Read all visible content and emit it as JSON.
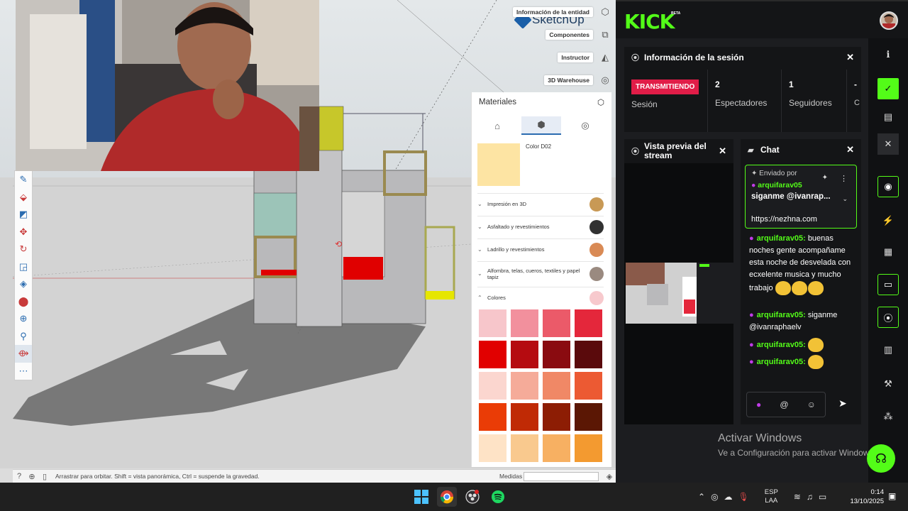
{
  "sketchup": {
    "logo_text": "SketchUp",
    "right_tools": [
      {
        "label": "Información de la entidad",
        "icon": "cube-info-icon",
        "glyph": "⬡"
      },
      {
        "label": "Componentes",
        "icon": "components-icon",
        "glyph": "⧉"
      },
      {
        "label": "Instructor",
        "icon": "instructor-icon",
        "glyph": "◭"
      },
      {
        "label": "3D Warehouse",
        "icon": "warehouse-icon",
        "glyph": "◎"
      }
    ],
    "left_tools": [
      "eraser-icon",
      "paint-bucket-icon",
      "rectangle-icon",
      "move-icon",
      "rotate-icon",
      "scale-icon",
      "tape-measure-icon",
      "pushpull-icon",
      "orbit-icon",
      "zoom-icon",
      "walk-icon",
      "more-icon"
    ],
    "status_text": "Arrastrar para orbitar. Shift = vista panorámica, Ctrl = suspende la gravedad.",
    "medidas_label": "Medidas",
    "materials": {
      "title": "Materiales",
      "tabs": [
        "house-icon",
        "box-icon",
        "target-icon"
      ],
      "selected_color": {
        "name": "Color D02",
        "hex": "#fde4a3"
      },
      "categories": [
        {
          "name": "Impresión en 3D",
          "swatch": "#c89955"
        },
        {
          "name": "Asfaltado y revestimientos",
          "swatch": "#323232"
        },
        {
          "name": "Ladrillo y revestimientos",
          "swatch": "#d98a55"
        },
        {
          "name": "Alfombra, telas, cueros, textiles y papel tapiz",
          "swatch": "#9a8a80"
        },
        {
          "name": "Colores",
          "swatch": "#f7c9cd",
          "expanded": true
        }
      ],
      "colors": [
        "#f7c6cb",
        "#f2909d",
        "#eb5a69",
        "#e4273b",
        "#e10000",
        "#b50b10",
        "#8a0b10",
        "#5a0a0c",
        "#fbd6cf",
        "#f5ab99",
        "#f08866",
        "#ec5a33",
        "#ea3c06",
        "#c02a05",
        "#8d1d04",
        "#5b1704",
        "#fee3c6",
        "#f9c98e",
        "#f7b062",
        "#f39a30"
      ]
    }
  },
  "kick": {
    "logo": "KICK",
    "beta": "BETA",
    "session": {
      "title": "Información de la sesión",
      "badge": "TRANSMITIENDO",
      "stats": [
        {
          "value": "",
          "label": "Sesión"
        },
        {
          "value": "2",
          "label": "Espectadores"
        },
        {
          "value": "1",
          "label": "Seguidores"
        },
        {
          "value": "-",
          "label": "C s"
        }
      ]
    },
    "preview": {
      "title": "Vista previa del stream"
    },
    "chat": {
      "title": "Chat",
      "pinned": {
        "label": "Enviado por",
        "user": "arquifarav05",
        "message": "siganme @ivanrap...",
        "link": "https://nezhna.com"
      },
      "messages": [
        {
          "user": "arquifarav05:",
          "text": "buenas noches gente acompañame esta noche de desvelada con ecxelente musica y mucho trabajo"
        },
        {
          "user": "arquifarav05:",
          "text": "siganme @ivanraphaelv"
        },
        {
          "user": "arquifarav05:",
          "text": ""
        },
        {
          "user": "arquifarav05:",
          "text": ""
        }
      ],
      "input_at": "@"
    },
    "rail": [
      "info-icon",
      "check-icon",
      "layout-icon",
      "close-icon",
      "camera-icon",
      "bolt-icon",
      "notes-icon",
      "chat-icon",
      "broadcast-icon",
      "media-icon",
      "wrench-icon",
      "share-icon"
    ]
  },
  "windows": {
    "activate_title": "Activar Windows",
    "activate_sub": "Ve a Configuración para activar Windows.",
    "lang_top": "ESP",
    "lang_bottom": "LAA",
    "time": "0:14",
    "date": "13/10/2025"
  }
}
